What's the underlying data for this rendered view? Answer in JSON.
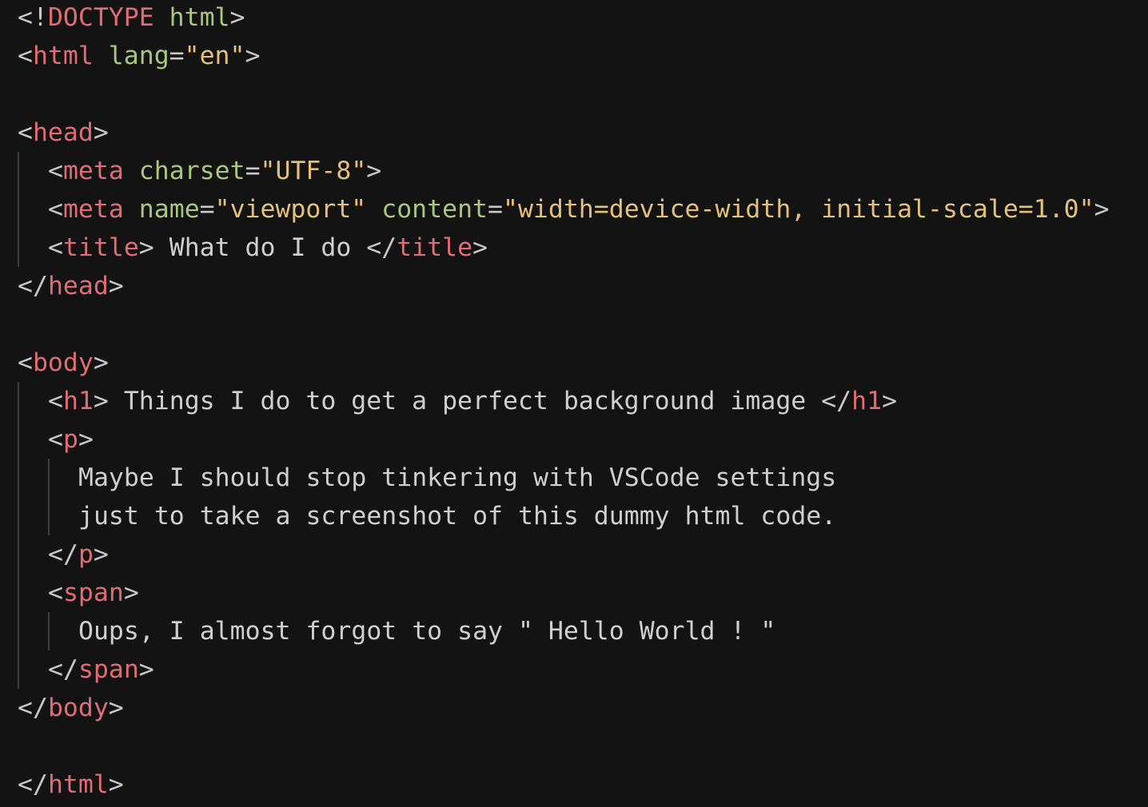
{
  "doctype": {
    "open": "<!",
    "keyword": "DOCTYPE",
    "name": "html",
    "close": ">"
  },
  "html_open": {
    "tag": "html",
    "attr": "lang",
    "value": "\"en\""
  },
  "head_open": {
    "tag": "head"
  },
  "meta_charset": {
    "tag": "meta",
    "attr": "charset",
    "value": "\"UTF-8\""
  },
  "meta_viewport": {
    "tag": "meta",
    "attr1": "name",
    "value1": "\"viewport\"",
    "attr2": "content",
    "value2": "\"width=device-width, initial-scale=1.0\""
  },
  "title_line": {
    "tag": "title",
    "text": " What do I do "
  },
  "head_close": {
    "tag": "head"
  },
  "body_open": {
    "tag": "body"
  },
  "h1_line": {
    "tag": "h1",
    "text": " Things I do to get a perfect background image "
  },
  "p_open": {
    "tag": "p"
  },
  "p_text": [
    "Maybe I should stop tinkering with VSCode settings",
    "just to take a screenshot of this dummy html code."
  ],
  "p_close": {
    "tag": "p"
  },
  "span_open": {
    "tag": "span"
  },
  "span_text": "Oups, I almost forgot to say \" Hello World ! \"",
  "span_close": {
    "tag": "span"
  },
  "body_close": {
    "tag": "body"
  },
  "html_close": {
    "tag": "html"
  },
  "theme": {
    "background": "#131313",
    "punctuation": "#c8c8c8",
    "tag": "#e06c75",
    "attribute": "#a9c77d",
    "string": "#e5c07b",
    "text": "#cfcfcf",
    "indent_guide": "#3e3e3e"
  }
}
